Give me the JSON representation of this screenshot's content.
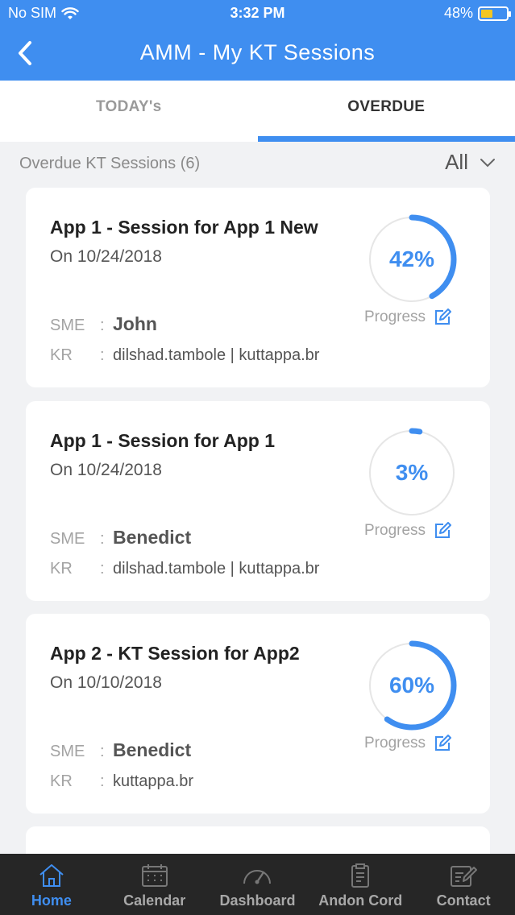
{
  "status_bar": {
    "carrier": "No SIM",
    "time": "3:32 PM",
    "battery": "48%",
    "battery_level": 0.48
  },
  "header": {
    "title": "AMM - My KT Sessions",
    "back_icon": "chevron-left-icon"
  },
  "tabs": [
    {
      "label": "TODAY's",
      "active": false
    },
    {
      "label": "OVERDUE",
      "active": true
    }
  ],
  "section": {
    "label": "Overdue KT Sessions (6)",
    "filter_value": "All"
  },
  "sessions": [
    {
      "title": "App 1 - Session for App 1 New",
      "date": "On 10/24/2018",
      "sme_label": "SME",
      "sme_sep": ":",
      "sme": "John",
      "kr_label": "KR",
      "kr_sep": ":",
      "kr": "dilshad.tambole | kuttappa.br",
      "progress": 0.42,
      "progress_text": "42%",
      "progress_label": "Progress"
    },
    {
      "title": "App 1 - Session for App 1",
      "date": "On 10/24/2018",
      "sme_label": "SME",
      "sme_sep": ":",
      "sme": "Benedict",
      "kr_label": "KR",
      "kr_sep": ":",
      "kr": "dilshad.tambole | kuttappa.br",
      "progress": 0.03,
      "progress_text": "3%",
      "progress_label": "Progress"
    },
    {
      "title": "App 2 - KT Session for App2",
      "date": "On 10/10/2018",
      "sme_label": "SME",
      "sme_sep": ":",
      "sme": "Benedict",
      "kr_label": "KR",
      "kr_sep": ":",
      "kr": "kuttappa.br",
      "progress": 0.6,
      "progress_text": "60%",
      "progress_label": "Progress"
    }
  ],
  "bottom_nav": [
    {
      "label": "Home",
      "icon": "home-icon",
      "active": true
    },
    {
      "label": "Calendar",
      "icon": "calendar-icon",
      "active": false
    },
    {
      "label": "Dashboard",
      "icon": "gauge-icon",
      "active": false
    },
    {
      "label": "Andon Cord",
      "icon": "clipboard-icon",
      "active": false
    },
    {
      "label": "Contact",
      "icon": "edit-note-icon",
      "active": false
    }
  ],
  "colors": {
    "primary": "#3f8ef0",
    "ring_track": "#e6e6e6",
    "nav_bg": "#262626"
  }
}
